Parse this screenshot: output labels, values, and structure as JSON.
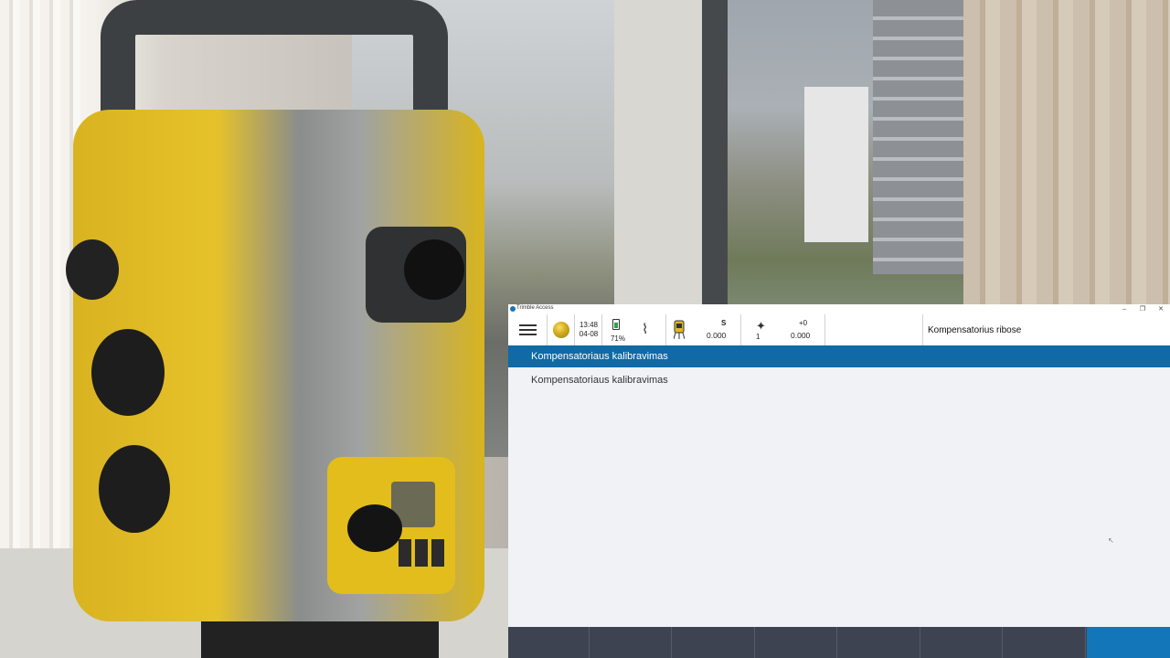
{
  "app": {
    "title": "Trimble Access",
    "accent": "#0f6aa5",
    "softkey_accent": "#1276b8"
  },
  "window_controls": {
    "minimize": "–",
    "restore": "❐",
    "close": "✕"
  },
  "status_bar": {
    "menu_icon": "hamburger-icon",
    "gnss_icon": "globe-icon",
    "time": "13:48",
    "date": "04-08",
    "battery_percent": "71%",
    "battery_level": 0.71,
    "connection_icon": "cable-icon",
    "instrument": {
      "icon": "total-station-icon",
      "label": "S",
      "value": "0.000"
    },
    "target": {
      "icon": "prism-target-icon",
      "number": "1",
      "label": "+0",
      "value": "0.000"
    },
    "page_title": "Kompensatorius ribose"
  },
  "list": {
    "selected": "Kompensatoriaus kalibravimas",
    "items": [
      "Kompensatoriaus kalibravimas"
    ]
  },
  "softkeys": [
    "",
    "",
    "",
    "",
    "",
    "",
    "",
    ""
  ]
}
